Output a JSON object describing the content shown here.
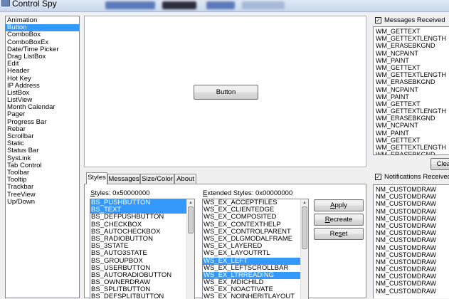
{
  "window": {
    "title": "Control Spy"
  },
  "controls": {
    "items": [
      "Animation",
      "Button",
      "ComboBox",
      "ComboBoxEx",
      "Date/Time Picker",
      "Drag ListBox",
      "Edit",
      "Header",
      "Hot Key",
      "IP Address",
      "ListBox",
      "ListView",
      "Month Calendar",
      "Pager",
      "Progress Bar",
      "Rebar",
      "Scrollbar",
      "Static",
      "Status Bar",
      "SysLink",
      "Tab Control",
      "Toolbar",
      "Tooltip",
      "Trackbar",
      "TreeView",
      "Up/Down"
    ],
    "selected": "Button"
  },
  "preview": {
    "button_label": "Button"
  },
  "tabs": [
    "Styles",
    "Messages",
    "Size/Color",
    "About"
  ],
  "active_tab": "Styles",
  "styles": {
    "label_prefix": "S",
    "label_rest": "tyles: 0x50000000",
    "items": [
      "BS_PUSHBUTTON",
      "BS_TEXT",
      "BS_DEFPUSHBUTTON",
      "BS_CHECKBOX",
      "BS_AUTOCHECKBOX",
      "BS_RADIOBUTTON",
      "BS_3STATE",
      "BS_AUTO3STATE",
      "BS_GROUPBOX",
      "BS_USERBUTTON",
      "BS_AUTORADIOBUTTON",
      "BS_OWNERDRAW",
      "BS_SPLITBUTTON",
      "BS_DEFSPLITBUTTON"
    ],
    "selected": [
      "BS_PUSHBUTTON",
      "BS_TEXT"
    ]
  },
  "ext_styles": {
    "label_prefix": "E",
    "label_rest": "xtended Styles: 0x00000000",
    "items": [
      "WS_EX_ACCEPTFILES",
      "WS_EX_CLIENTEDGE",
      "WS_EX_COMPOSITED",
      "WS_EX_CONTEXTHELP",
      "WS_EX_CONTROLPARENT",
      "WS_EX_DLGMODALFRAME",
      "WS_EX_LAYERED",
      "WS_EX_LAYOUTRTL",
      "WS_EX_LEFT",
      "WS_EX_LEFTSCROLLBAR",
      "WS_EX_LTRREADING",
      "WS_EX_MDICHILD",
      "WS_EX_NOACTIVATE",
      "WS_EX_NOINHERITLAYOUT"
    ],
    "selected": [
      "WS_EX_LEFT",
      "WS_EX_LTRREADING"
    ]
  },
  "actions": {
    "apply": {
      "u": "A",
      "rest": "pply"
    },
    "recreate": {
      "u": "R",
      "rest": "ecreate"
    },
    "reset": {
      "u": "",
      "pre": "Re",
      "ul": "s",
      "rest": "et"
    }
  },
  "messages": {
    "label": "Messages Received",
    "checked": true,
    "items": [
      "WM_GETTEXT",
      "WM_GETTEXTLENGTH",
      "WM_ERASEBKGND",
      "WM_NCPAINT",
      "WM_PAINT",
      "WM_GETTEXT",
      "WM_GETTEXTLENGTH",
      "WM_ERASEBKGND",
      "WM_NCPAINT",
      "WM_PAINT",
      "WM_GETTEXT",
      "WM_GETTEXTLENGTH",
      "WM_ERASEBKGND",
      "WM_NCPAINT",
      "WM_PAINT",
      "WM_GETTEXT",
      "WM_GETTEXTLENGTH",
      "WM_ERASEBKGND"
    ],
    "clear_label": "Clear"
  },
  "notifications": {
    "label": "Notifications Received",
    "checked": true,
    "items": [
      "NM_CUSTOMDRAW",
      "NM_CUSTOMDRAW",
      "NM_CUSTOMDRAW",
      "NM_CUSTOMDRAW",
      "NM_CUSTOMDRAW",
      "NM_CUSTOMDRAW",
      "NM_CUSTOMDRAW",
      "NM_CUSTOMDRAW",
      "NM_CUSTOMDRAW",
      "NM_CUSTOMDRAW",
      "NM_CUSTOMDRAW",
      "NM_CUSTOMDRAW",
      "NM_CUSTOMDRAW",
      "NM_CUSTOMDRAW",
      "NM_CUSTOMDRAW"
    ]
  },
  "colors": {
    "selection": "#3399ff"
  }
}
